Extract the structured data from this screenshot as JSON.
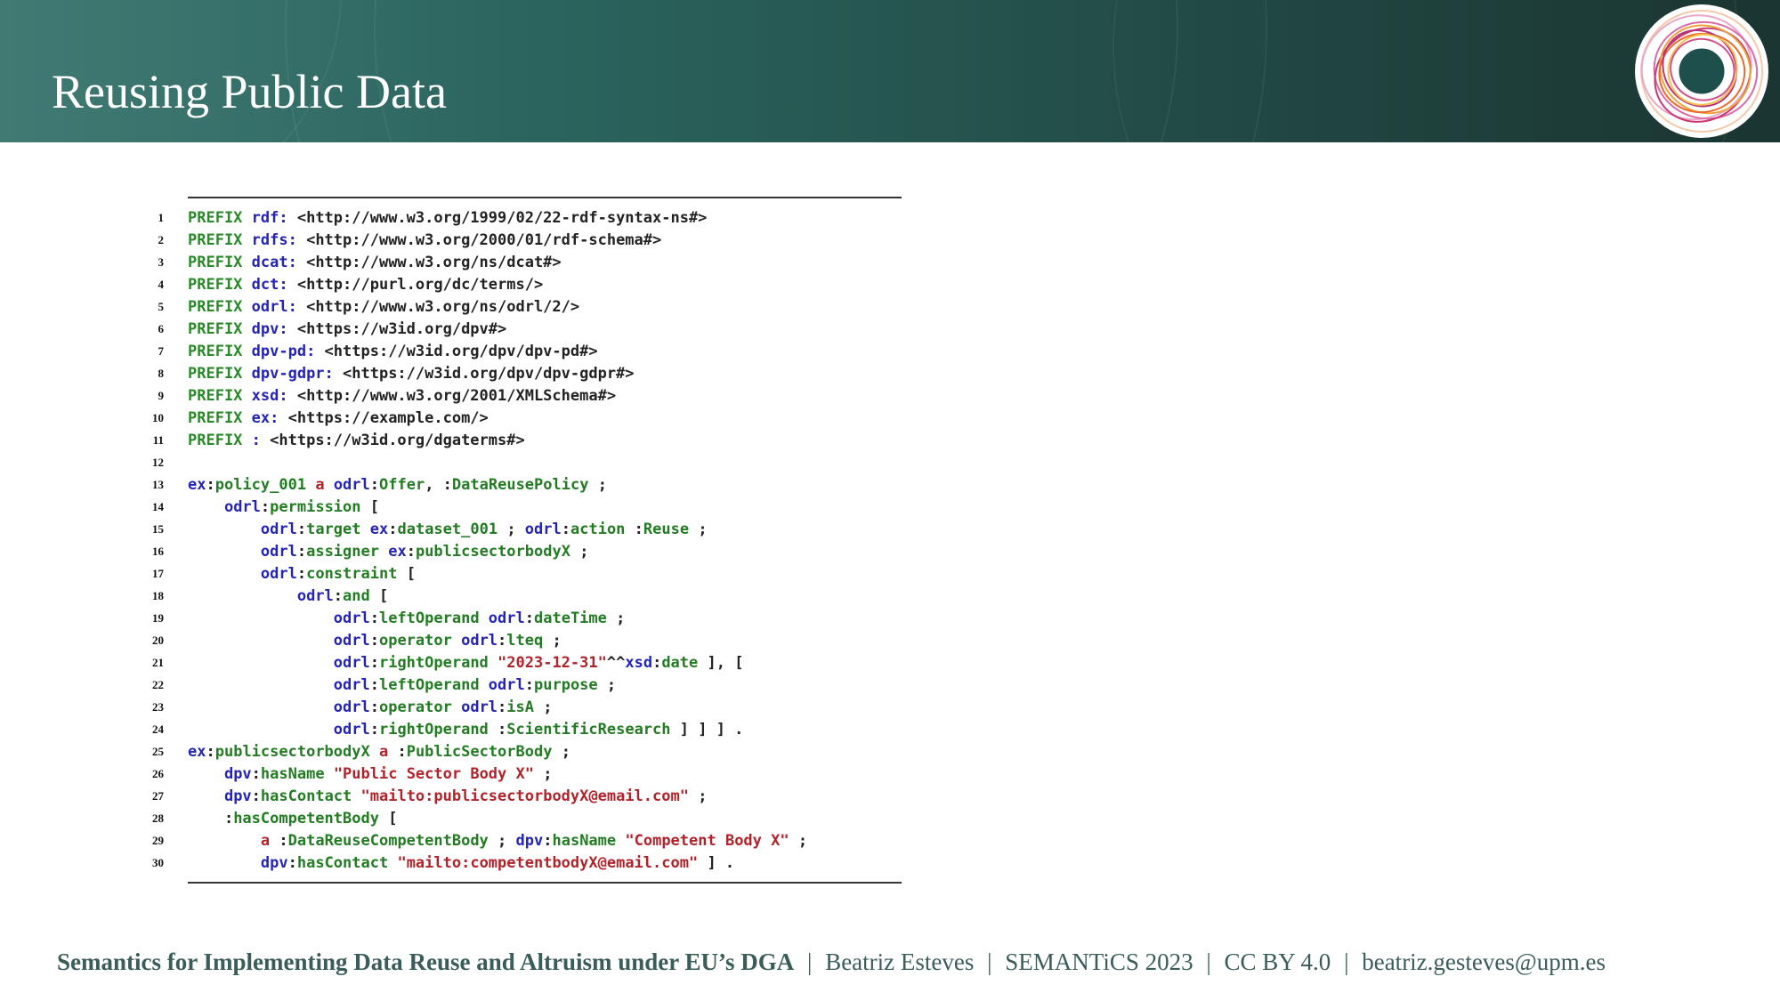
{
  "slide": {
    "title": "Reusing Public Data"
  },
  "code": {
    "lines": [
      {
        "n": "1",
        "tokens": [
          [
            "kw",
            "PREFIX "
          ],
          [
            "blue",
            "rdf: "
          ],
          [
            "plain",
            "<http://www.w3.org/1999/02/22-rdf-syntax-ns#>"
          ]
        ]
      },
      {
        "n": "2",
        "tokens": [
          [
            "kw",
            "PREFIX "
          ],
          [
            "blue",
            "rdfs: "
          ],
          [
            "plain",
            "<http://www.w3.org/2000/01/rdf-schema#>"
          ]
        ]
      },
      {
        "n": "3",
        "tokens": [
          [
            "kw",
            "PREFIX "
          ],
          [
            "blue",
            "dcat: "
          ],
          [
            "plain",
            "<http://www.w3.org/ns/dcat#>"
          ]
        ]
      },
      {
        "n": "4",
        "tokens": [
          [
            "kw",
            "PREFIX "
          ],
          [
            "blue",
            "dct: "
          ],
          [
            "plain",
            "<http://purl.org/dc/terms/>"
          ]
        ]
      },
      {
        "n": "5",
        "tokens": [
          [
            "kw",
            "PREFIX "
          ],
          [
            "blue",
            "odrl: "
          ],
          [
            "plain",
            "<http://www.w3.org/ns/odrl/2/>"
          ]
        ]
      },
      {
        "n": "6",
        "tokens": [
          [
            "kw",
            "PREFIX "
          ],
          [
            "blue",
            "dpv: "
          ],
          [
            "plain",
            "<https://w3id.org/dpv#>"
          ]
        ]
      },
      {
        "n": "7",
        "tokens": [
          [
            "kw",
            "PREFIX "
          ],
          [
            "blue",
            "dpv-pd: "
          ],
          [
            "plain",
            "<https://w3id.org/dpv/dpv-pd#>"
          ]
        ]
      },
      {
        "n": "8",
        "tokens": [
          [
            "kw",
            "PREFIX "
          ],
          [
            "blue",
            "dpv-gdpr: "
          ],
          [
            "plain",
            "<https://w3id.org/dpv/dpv-gdpr#>"
          ]
        ]
      },
      {
        "n": "9",
        "tokens": [
          [
            "kw",
            "PREFIX "
          ],
          [
            "blue",
            "xsd: "
          ],
          [
            "plain",
            "<http://www.w3.org/2001/XMLSchema#>"
          ]
        ]
      },
      {
        "n": "10",
        "tokens": [
          [
            "kw",
            "PREFIX "
          ],
          [
            "blue",
            "ex: "
          ],
          [
            "plain",
            "<https://example.com/>"
          ]
        ]
      },
      {
        "n": "11",
        "tokens": [
          [
            "kw",
            "PREFIX "
          ],
          [
            "blue",
            ": "
          ],
          [
            "plain",
            "<https://w3id.org/dgaterms#>"
          ]
        ]
      },
      {
        "n": "12",
        "tokens": []
      },
      {
        "n": "13",
        "tokens": [
          [
            "blue",
            "ex"
          ],
          [
            "plain",
            ":"
          ],
          [
            "green",
            "policy_001 "
          ],
          [
            "red",
            "a "
          ],
          [
            "blue",
            "odrl"
          ],
          [
            "plain",
            ":"
          ],
          [
            "green",
            "Offer"
          ],
          [
            "plain",
            ", :"
          ],
          [
            "green",
            "DataReusePolicy"
          ],
          [
            "plain",
            " ;"
          ]
        ]
      },
      {
        "n": "14",
        "tokens": [
          [
            "plain",
            "    "
          ],
          [
            "blue",
            "odrl"
          ],
          [
            "plain",
            ":"
          ],
          [
            "green",
            "permission"
          ],
          [
            "plain",
            " ["
          ]
        ]
      },
      {
        "n": "15",
        "tokens": [
          [
            "plain",
            "        "
          ],
          [
            "blue",
            "odrl"
          ],
          [
            "plain",
            ":"
          ],
          [
            "green",
            "target "
          ],
          [
            "blue",
            "ex"
          ],
          [
            "plain",
            ":"
          ],
          [
            "green",
            "dataset_001"
          ],
          [
            "plain",
            " ; "
          ],
          [
            "blue",
            "odrl"
          ],
          [
            "plain",
            ":"
          ],
          [
            "green",
            "action"
          ],
          [
            "plain",
            " :"
          ],
          [
            "green",
            "Reuse"
          ],
          [
            "plain",
            " ;"
          ]
        ]
      },
      {
        "n": "16",
        "tokens": [
          [
            "plain",
            "        "
          ],
          [
            "blue",
            "odrl"
          ],
          [
            "plain",
            ":"
          ],
          [
            "green",
            "assigner "
          ],
          [
            "blue",
            "ex"
          ],
          [
            "plain",
            ":"
          ],
          [
            "green",
            "publicsectorbodyX"
          ],
          [
            "plain",
            " ;"
          ]
        ]
      },
      {
        "n": "17",
        "tokens": [
          [
            "plain",
            "        "
          ],
          [
            "blue",
            "odrl"
          ],
          [
            "plain",
            ":"
          ],
          [
            "green",
            "constraint"
          ],
          [
            "plain",
            " ["
          ]
        ]
      },
      {
        "n": "18",
        "tokens": [
          [
            "plain",
            "            "
          ],
          [
            "blue",
            "odrl"
          ],
          [
            "plain",
            ":"
          ],
          [
            "green",
            "and"
          ],
          [
            "plain",
            " ["
          ]
        ]
      },
      {
        "n": "19",
        "tokens": [
          [
            "plain",
            "                "
          ],
          [
            "blue",
            "odrl"
          ],
          [
            "plain",
            ":"
          ],
          [
            "green",
            "leftOperand "
          ],
          [
            "blue",
            "odrl"
          ],
          [
            "plain",
            ":"
          ],
          [
            "green",
            "dateTime"
          ],
          [
            "plain",
            " ;"
          ]
        ]
      },
      {
        "n": "20",
        "tokens": [
          [
            "plain",
            "                "
          ],
          [
            "blue",
            "odrl"
          ],
          [
            "plain",
            ":"
          ],
          [
            "green",
            "operator "
          ],
          [
            "blue",
            "odrl"
          ],
          [
            "plain",
            ":"
          ],
          [
            "green",
            "lteq"
          ],
          [
            "plain",
            " ;"
          ]
        ]
      },
      {
        "n": "21",
        "tokens": [
          [
            "plain",
            "                "
          ],
          [
            "blue",
            "odrl"
          ],
          [
            "plain",
            ":"
          ],
          [
            "green",
            "rightOperand "
          ],
          [
            "red",
            "\"2023-12-31\""
          ],
          [
            "plain",
            "^^"
          ],
          [
            "blue",
            "xsd"
          ],
          [
            "plain",
            ":"
          ],
          [
            "green",
            "date"
          ],
          [
            "plain",
            " ], ["
          ]
        ]
      },
      {
        "n": "22",
        "tokens": [
          [
            "plain",
            "                "
          ],
          [
            "blue",
            "odrl"
          ],
          [
            "plain",
            ":"
          ],
          [
            "green",
            "leftOperand "
          ],
          [
            "blue",
            "odrl"
          ],
          [
            "plain",
            ":"
          ],
          [
            "green",
            "purpose"
          ],
          [
            "plain",
            " ;"
          ]
        ]
      },
      {
        "n": "23",
        "tokens": [
          [
            "plain",
            "                "
          ],
          [
            "blue",
            "odrl"
          ],
          [
            "plain",
            ":"
          ],
          [
            "green",
            "operator "
          ],
          [
            "blue",
            "odrl"
          ],
          [
            "plain",
            ":"
          ],
          [
            "green",
            "isA"
          ],
          [
            "plain",
            " ;"
          ]
        ]
      },
      {
        "n": "24",
        "tokens": [
          [
            "plain",
            "                "
          ],
          [
            "blue",
            "odrl"
          ],
          [
            "plain",
            ":"
          ],
          [
            "green",
            "rightOperand "
          ],
          [
            "plain",
            ":"
          ],
          [
            "green",
            "ScientificResearch"
          ],
          [
            "plain",
            " ] ] ] ."
          ]
        ]
      },
      {
        "n": "25",
        "tokens": [
          [
            "blue",
            "ex"
          ],
          [
            "plain",
            ":"
          ],
          [
            "green",
            "publicsectorbodyX "
          ],
          [
            "red",
            "a "
          ],
          [
            "plain",
            ":"
          ],
          [
            "green",
            "PublicSectorBody"
          ],
          [
            "plain",
            " ;"
          ]
        ]
      },
      {
        "n": "26",
        "tokens": [
          [
            "plain",
            "    "
          ],
          [
            "blue",
            "dpv"
          ],
          [
            "plain",
            ":"
          ],
          [
            "green",
            "hasName "
          ],
          [
            "red",
            "\"Public Sector Body X\""
          ],
          [
            "plain",
            " ;"
          ]
        ]
      },
      {
        "n": "27",
        "tokens": [
          [
            "plain",
            "    "
          ],
          [
            "blue",
            "dpv"
          ],
          [
            "plain",
            ":"
          ],
          [
            "green",
            "hasContact "
          ],
          [
            "red",
            "\"mailto:publicsectorbodyX@email.com\""
          ],
          [
            "plain",
            " ;"
          ]
        ]
      },
      {
        "n": "28",
        "tokens": [
          [
            "plain",
            "    :"
          ],
          [
            "green",
            "hasCompetentBody"
          ],
          [
            "plain",
            " ["
          ]
        ]
      },
      {
        "n": "29",
        "tokens": [
          [
            "plain",
            "        "
          ],
          [
            "red",
            "a "
          ],
          [
            "plain",
            ":"
          ],
          [
            "green",
            "DataReuseCompetentBody"
          ],
          [
            "plain",
            " ; "
          ],
          [
            "blue",
            "dpv"
          ],
          [
            "plain",
            ":"
          ],
          [
            "green",
            "hasName "
          ],
          [
            "red",
            "\"Competent Body X\""
          ],
          [
            "plain",
            " ;"
          ]
        ]
      },
      {
        "n": "30",
        "tokens": [
          [
            "plain",
            "        "
          ],
          [
            "blue",
            "dpv"
          ],
          [
            "plain",
            ":"
          ],
          [
            "green",
            "hasContact "
          ],
          [
            "red",
            "\"mailto:competentbodyX@email.com\""
          ],
          [
            "plain",
            " ] ."
          ]
        ]
      }
    ]
  },
  "footer": {
    "title": "Semantics for Implementing Data Reuse and Altruism under EU’s DGA",
    "separator": "|",
    "author": "Beatriz Esteves",
    "event": "SEMANTiCS 2023",
    "license": "CC BY 4.0",
    "email": "beatriz.gesteves@upm.es"
  },
  "colors": {
    "keyword": "#2a8a2a",
    "prefix": "#2424b5",
    "term": "#237c23",
    "literal": "#b0232a",
    "footer_text": "#3b5d5a",
    "header_bg": "#2b645e"
  },
  "icons": {
    "logo": "circular-swirl-logo-icon"
  }
}
